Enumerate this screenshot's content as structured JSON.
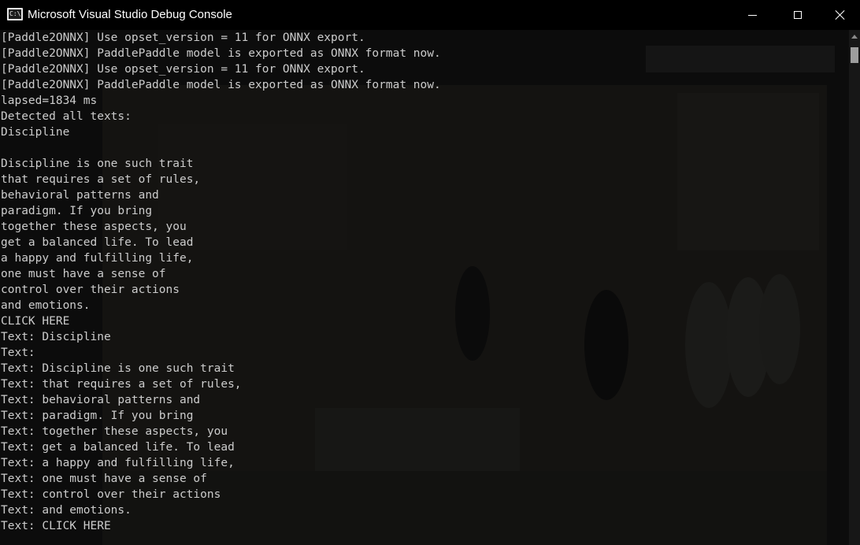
{
  "window": {
    "title": "Microsoft Visual Studio Debug Console",
    "icon_text": "C:\\",
    "icon_name": "console-app-icon"
  },
  "controls": {
    "minimize_icon": "minimize-icon",
    "maximize_icon": "maximize-icon",
    "close_icon": "close-icon"
  },
  "console": {
    "text_color": "#cccccc",
    "background_color": "#0c0c0c",
    "lines": [
      "[Paddle2ONNX] Use opset_version = 11 for ONNX export.",
      "[Paddle2ONNX] PaddlePaddle model is exported as ONNX format now.",
      "[Paddle2ONNX] Use opset_version = 11 for ONNX export.",
      "[Paddle2ONNX] PaddlePaddle model is exported as ONNX format now.",
      "lapsed=1834 ms",
      "Detected all texts:",
      "Discipline",
      "",
      "Discipline is one such trait",
      "that requires a set of rules,",
      "behavioral patterns and",
      "paradigm. If you bring",
      "together these aspects, you",
      "get a balanced life. To lead",
      "a happy and fulfilling life,",
      "one must have a sense of",
      "control over their actions",
      "and emotions.",
      "CLICK HERE",
      "Text: Discipline",
      "Text:",
      "Text: Discipline is one such trait",
      "Text: that requires a set of rules,",
      "Text: behavioral patterns and",
      "Text: paradigm. If you bring",
      "Text: together these aspects, you",
      "Text: get a balanced life. To lead",
      "Text: a happy and fulfilling life,",
      "Text: one must have a sense of",
      "Text: control over their actions",
      "Text: and emotions.",
      "Text: CLICK HERE"
    ]
  }
}
